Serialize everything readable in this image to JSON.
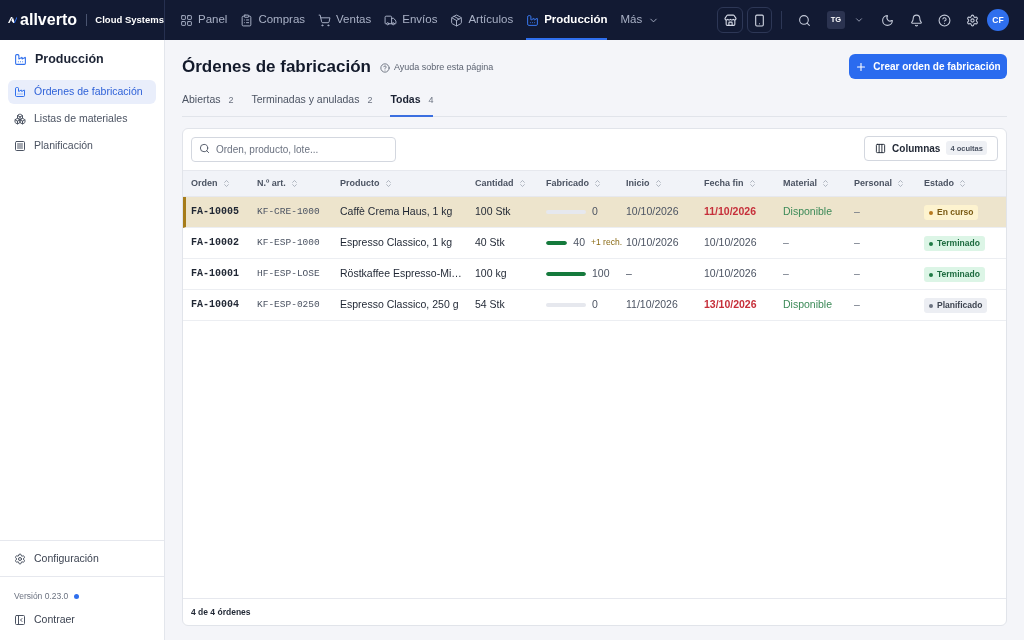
{
  "brand": {
    "name": "allverto",
    "product": "Cloud Systems"
  },
  "nav": [
    {
      "label": "Panel",
      "selected": false
    },
    {
      "label": "Compras",
      "selected": false
    },
    {
      "label": "Ventas",
      "selected": false
    },
    {
      "label": "Envíos",
      "selected": false
    },
    {
      "label": "Artículos",
      "selected": false
    },
    {
      "label": "Producción",
      "selected": true
    }
  ],
  "nav_more": {
    "label": "Más"
  },
  "workspace": "TG",
  "avatar": "CF",
  "sidebar": {
    "title": "Producción",
    "items": [
      {
        "label": "Órdenes de fabricación",
        "selected": true
      },
      {
        "label": "Listas de materiales",
        "selected": false
      },
      {
        "label": "Planificación",
        "selected": false
      }
    ],
    "settings": "Configuración",
    "version": "Versión 0.23.0",
    "collapse": "Contraer"
  },
  "page": {
    "title": "Órdenes de fabricación",
    "help": "Ayuda sobre esta página",
    "create_button": "Crear orden de fabricación"
  },
  "tabs": [
    {
      "label": "Abiertas",
      "count": "2",
      "selected": false
    },
    {
      "label": "Terminadas y anuladas",
      "count": "2",
      "selected": false
    },
    {
      "label": "Todas",
      "count": "4",
      "selected": true
    }
  ],
  "table": {
    "search": {
      "placeholder": "Orden, producto, lote..."
    },
    "columns_button": {
      "label": "Columnas",
      "badge": "4 ocultas"
    },
    "columns": [
      "Orden",
      "N.º art.",
      "Producto",
      "Cantidad",
      "Fabricado",
      "Inicio",
      "Fecha fin",
      "Material",
      "Personal",
      "Estado"
    ],
    "rows": [
      {
        "selected": true,
        "order": "FA-10005",
        "article": "KF-CRE-1000",
        "product": "Caffè Crema Haus, 1 kg",
        "quantity": "100 Stk",
        "made": {
          "level": 0,
          "value": "0"
        },
        "start": "10/10/2026",
        "end": {
          "text": "11/10/2026",
          "overdue": true
        },
        "material": {
          "text": "Disponible",
          "available": true
        },
        "staff": "–",
        "status": {
          "label": "En curso",
          "kind": "in_progress",
          "color": "#b7791f"
        }
      },
      {
        "selected": false,
        "order": "FA-10002",
        "article": "KF-ESP-1000",
        "product": "Espresso Classico, 1 kg",
        "quantity": "40 Stk",
        "made": {
          "level": 1,
          "value": "40",
          "rejected": "+1 rech."
        },
        "start": "10/10/2026",
        "end": {
          "text": "10/10/2026",
          "overdue": false
        },
        "material": {
          "text": "–",
          "available": false
        },
        "staff": "–",
        "status": {
          "label": "Terminado",
          "kind": "done",
          "color": "#1f7a45"
        }
      },
      {
        "selected": false,
        "order": "FA-10001",
        "article": "HF-ESP-LOSE",
        "product": "Röstkaffee Espresso-Mi…",
        "quantity": "100 kg",
        "made": {
          "level": 1,
          "value": "100"
        },
        "start": "–",
        "end": {
          "text": "10/10/2026",
          "overdue": false
        },
        "material": {
          "text": "–",
          "available": false
        },
        "staff": "–",
        "status": {
          "label": "Terminado",
          "kind": "done",
          "color": "#1f7a45"
        }
      },
      {
        "selected": false,
        "order": "FA-10004",
        "article": "KF-ESP-0250",
        "product": "Espresso Classico, 250 g",
        "quantity": "54 Stk",
        "made": {
          "level": 0,
          "value": "0"
        },
        "start": "11/10/2026",
        "end": {
          "text": "13/10/2026",
          "overdue": true
        },
        "material": {
          "text": "Disponible",
          "available": true
        },
        "staff": "–",
        "status": {
          "label": "Planificado",
          "kind": "planned",
          "color": "#6b7280"
        }
      }
    ],
    "footer": "4 de 4 órdenes"
  }
}
